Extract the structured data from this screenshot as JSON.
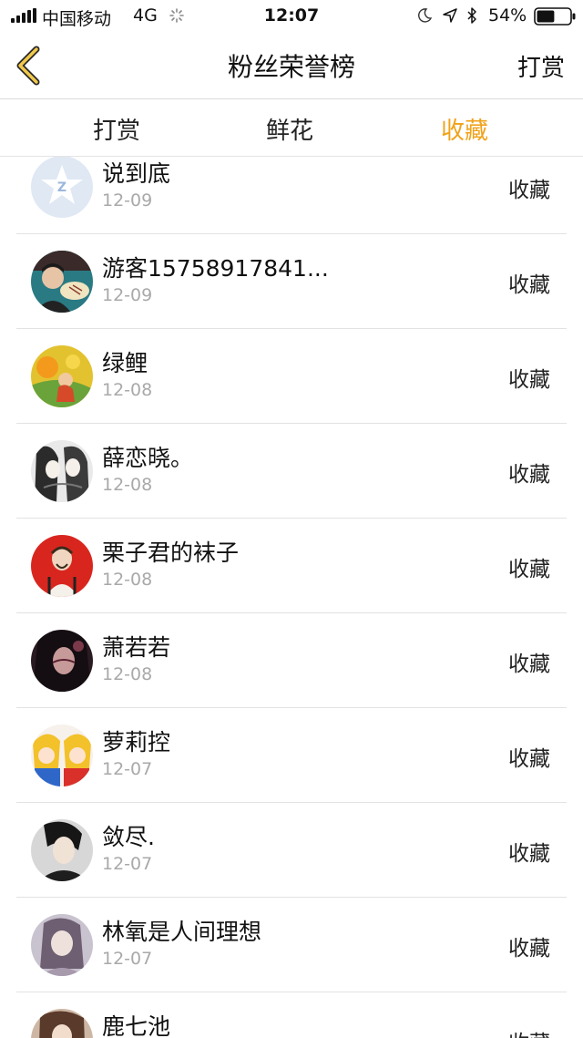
{
  "status_bar": {
    "carrier": "中国移动",
    "network": "4G",
    "time": "12:07",
    "battery_percent": "54%",
    "battery_level": 0.54
  },
  "nav": {
    "back_icon": "chevron-left-icon",
    "title": "粉丝荣誉榜",
    "right_button": "打赏",
    "accent_color": "#f0a21a"
  },
  "tabs": [
    {
      "label": "打赏",
      "active": false
    },
    {
      "label": "鲜花",
      "active": false
    },
    {
      "label": "收藏",
      "active": true
    }
  ],
  "list": [
    {
      "name": "说到底",
      "date": "12-09",
      "action": "收藏"
    },
    {
      "name": "游客15758917841...",
      "date": "12-09",
      "action": "收藏"
    },
    {
      "name": "绿鲤",
      "date": "12-08",
      "action": "收藏"
    },
    {
      "name": "薛恋晓。",
      "date": "12-08",
      "action": "收藏"
    },
    {
      "name": "栗子君的袜子",
      "date": "12-08",
      "action": "收藏"
    },
    {
      "name": "萧若若",
      "date": "12-08",
      "action": "收藏"
    },
    {
      "name": "萝莉控",
      "date": "12-07",
      "action": "收藏"
    },
    {
      "name": "敛尽.",
      "date": "12-07",
      "action": "收藏"
    },
    {
      "name": "林氧是人间理想",
      "date": "12-07",
      "action": "收藏"
    },
    {
      "name": "鹿七池",
      "date": "",
      "action": "收藏"
    }
  ]
}
